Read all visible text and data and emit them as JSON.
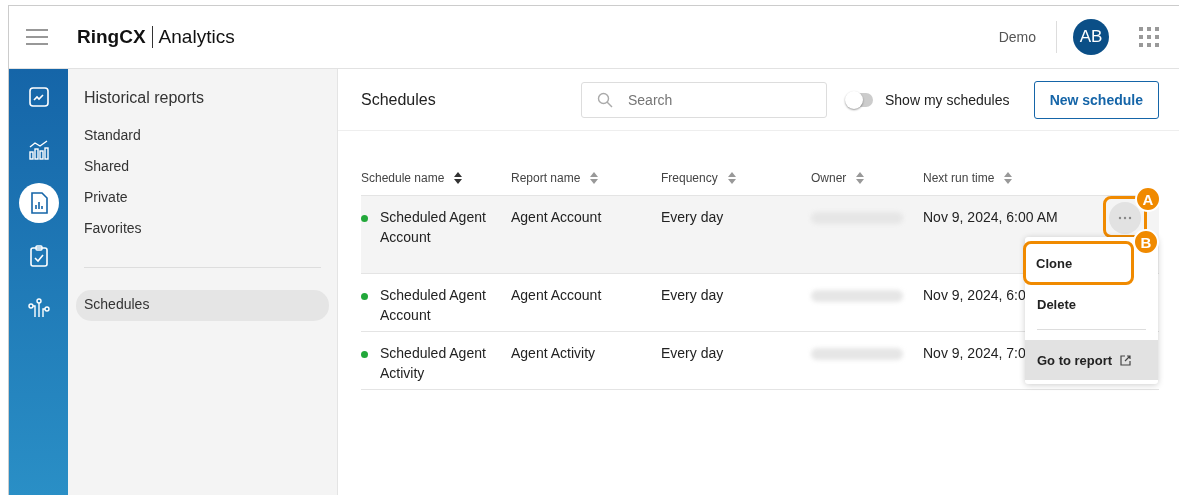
{
  "header": {
    "brand": "RingCX",
    "product": "Analytics",
    "account": "Demo",
    "avatar": "AB"
  },
  "rail": [
    {
      "selected": false
    },
    {
      "selected": false
    },
    {
      "selected": true
    },
    {
      "selected": false
    },
    {
      "selected": false
    }
  ],
  "sidebar": {
    "title": "Historical reports",
    "items": [
      {
        "label": "Standard",
        "selected": false
      },
      {
        "label": "Shared",
        "selected": false
      },
      {
        "label": "Private",
        "selected": false
      },
      {
        "label": "Favorites",
        "selected": false
      }
    ],
    "lower_items": [
      {
        "label": "Schedules",
        "selected": true
      }
    ]
  },
  "toolbar": {
    "title": "Schedules",
    "search": {
      "placeholder": "Search"
    },
    "toggle": {
      "label": "Show my schedules",
      "on": false
    },
    "button": "New schedule"
  },
  "table": {
    "columns": [
      {
        "label": "Schedule name",
        "sorted": true
      },
      {
        "label": "Report name",
        "sorted": false
      },
      {
        "label": "Frequency",
        "sorted": false
      },
      {
        "label": "Owner",
        "sorted": false
      },
      {
        "label": "Next run time",
        "sorted": false
      }
    ],
    "rows": [
      {
        "name": "Scheduled Agent Account",
        "color": "#22a83a",
        "report": "Agent Account",
        "frequency": "Every day",
        "next_run": "Nov 9, 2024, 6:00 AM",
        "selected": true
      },
      {
        "name": "Scheduled Agent Account",
        "color": "#22a83a",
        "report": "Agent Account",
        "frequency": "Every day",
        "next_run": "Nov 9, 2024, 6:0",
        "selected": false
      },
      {
        "name": "Scheduled Agent Activity",
        "color": "#22a83a",
        "report": "Agent Activity",
        "frequency": "Every day",
        "next_run": "Nov 9, 2024, 7:0",
        "selected": false
      }
    ]
  },
  "actions_callout": "A",
  "menu": [
    {
      "kind": "item",
      "label": "Clone",
      "callout": "B",
      "highlighted": false
    },
    {
      "kind": "item",
      "label": "Delete",
      "highlighted": false
    },
    {
      "kind": "divider"
    },
    {
      "kind": "link",
      "label": "Go to report",
      "highlighted": true
    }
  ]
}
